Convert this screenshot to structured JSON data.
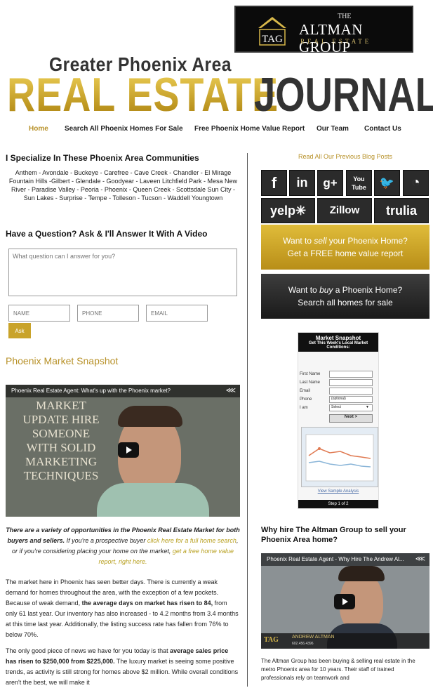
{
  "brand": {
    "logo_tag": "TAG",
    "logo_the": "THE",
    "logo_name": "ALTMAN GROUP",
    "logo_sub": "REAL ESTATE",
    "masthead_top": "Greater Phoenix Area",
    "masthead_re": "REAL ESTATE",
    "masthead_journal": "JOURNAL"
  },
  "nav": [
    {
      "label": "Home",
      "active": true
    },
    {
      "label": "Search All Phoenix Homes For Sale"
    },
    {
      "label": "Free Phoenix Home Value Report"
    },
    {
      "label": "Our Team"
    },
    {
      "label": "Contact Us"
    }
  ],
  "left": {
    "communities_title": "I Specialize In These Phoenix Area Communities",
    "communities": "Anthem - Avondale - Buckeye - Carefree - Cave Creek - Chandler - El Mirage Fountain Hills -Gilbert - Glendale - Goodyear - Laveen Litchfield Park - Mesa New River - Paradise Valley - Peoria - Phoenix - Queen Creek - Scottsdale Sun City - Sun Lakes - Surprise - Tempe - Tolleson - Tucson - Waddell Youngtown",
    "question_title": "Have a Question? Ask & I'll Answer It With A Video",
    "question_placeholder": "What question can I answer for you?",
    "name_placeholder": "NAME",
    "phone_placeholder": "PHONE",
    "email_placeholder": "EMAIL",
    "ask_label": "Ask",
    "snapshot_title": "Phoenix Market Snapshot",
    "video_title": "Phoenix Real Estate Agent: What's up with the Phoenix market?",
    "video_text": "MARKET UPDATE HIRE SOMEONE WITH SOLID MARKETING TECHNIQUES",
    "intro_bold": "There are a variety of opportunities in the Phoenix Real Estate Market for both buyers and sellers.",
    "intro_mid": " If you're a prospective buyer ",
    "intro_link1": "click here for a full home search",
    "intro_mid2": ", or if you're considering placing your home on the market, ",
    "intro_link2": "get a free home value report, right here.",
    "p1_a": "The market here in Phoenix has seen better days. There is currently a weak demand for homes throughout the area, with the exception of a few pockets. Because of weak demand, ",
    "p1_b": "the average days on market has risen to 84,",
    "p1_c": " from only 61 last year. Our inventory has also increased - to 4.2 months from 3.4 months at this time last year. Additionally, the listing success rate has fallen from 76% to below 70%.",
    "p2_a": "The only good piece of news we have for you today is that ",
    "p2_b": "average sales price has risen to $250,000 from $225,000.",
    "p2_c": " The luxury market is seeing some positive trends, as activity is still strong for homes above $2 million. While overall conditions aren't the best, we will make it"
  },
  "right": {
    "blog_link": "Read All Our Previous Blog Posts",
    "social": [
      {
        "icon": "facebook-icon",
        "glyph": "f"
      },
      {
        "icon": "linkedin-icon",
        "glyph": "in"
      },
      {
        "icon": "googleplus-icon",
        "glyph": "g+"
      },
      {
        "icon": "youtube-icon",
        "glyph": "You Tube"
      },
      {
        "icon": "twitter-icon",
        "glyph": "🐦"
      },
      {
        "icon": "rss-icon",
        "glyph": "◔"
      },
      {
        "icon": "yelp-icon",
        "glyph": "yelp✳"
      },
      {
        "icon": "zillow-icon",
        "glyph": "Zillow"
      },
      {
        "icon": "trulia-icon",
        "glyph": "trulia"
      }
    ],
    "cta_sell_1": "Want to ",
    "cta_sell_em": "sell",
    "cta_sell_2": " your Phoenix Home?",
    "cta_sell_3": "Get a FREE home value report",
    "cta_buy_1": "Want to ",
    "cta_buy_em": "buy",
    "cta_buy_2": " a Phoenix Home?",
    "cta_buy_3": "Search all homes for sale",
    "snap_title": "Market Snapshot",
    "snap_sub": "Get This Week's Local Market Conditions:",
    "snap_first": "First Name",
    "snap_last": "Last Name",
    "snap_email": "Email",
    "snap_phone": "Phone",
    "snap_optional": "(optional)",
    "snap_iam": "I am",
    "snap_select": "Select",
    "snap_next": "Next >",
    "snap_link": "View Sample Analysis",
    "snap_step": "Step 1 of 2",
    "why_title": "Why hire The Altman Group to sell your Phoenix Area home?",
    "video2_title": "Phoenix Real Estate Agent - Why Hire The Andrew Al...",
    "video2_name": "ANDREW ALTMAN",
    "video2_phone": "602.456.4396",
    "why_text": "The Altman Group has been buying & selling real estate in the metro Phoenix area for 10 years. Their staff of trained professionals rely on teamwork and"
  }
}
